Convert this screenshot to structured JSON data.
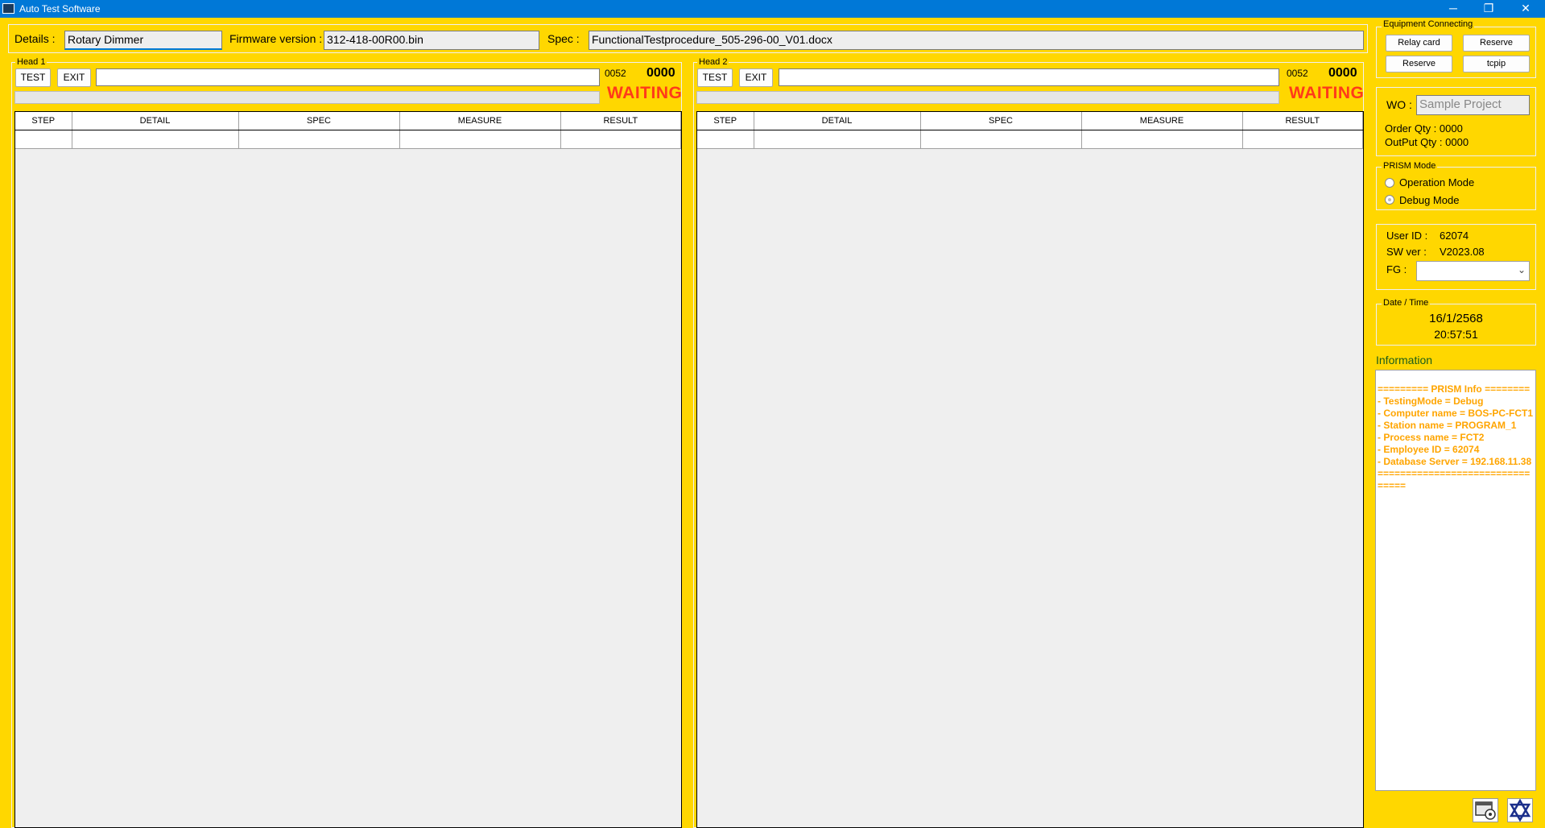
{
  "window": {
    "title": "Auto Test Software",
    "min": "─",
    "max": "❐",
    "close": "✕"
  },
  "header": {
    "details_label": "Details :",
    "details_value": "Rotary Dimmer",
    "firmware_label": "Firmware version :",
    "firmware_value": "312-418-00R00.bin",
    "spec_label": "Spec :",
    "spec_value": "FunctionalTestprocedure_505-296-00_V01.docx"
  },
  "heads": [
    {
      "title": "Head 1",
      "test": "TEST",
      "exit": "EXIT",
      "code": "0052",
      "count": "0000",
      "status": "WAITING",
      "progress": 0,
      "columns": [
        "STEP",
        "DETAIL",
        "SPEC",
        "MEASURE",
        "RESULT"
      ]
    },
    {
      "title": "Head 2",
      "test": "TEST",
      "exit": "EXIT",
      "code": "0052",
      "count": "0000",
      "status": "WAITING",
      "progress": 0,
      "columns": [
        "STEP",
        "DETAIL",
        "SPEC",
        "MEASURE",
        "RESULT"
      ]
    }
  ],
  "equipment": {
    "title": "Equipment Connecting",
    "buttons": [
      "Relay card",
      "Reserve",
      "Reserve",
      "tcpip"
    ]
  },
  "workorder": {
    "wo_label": "WO :",
    "wo_value": "Sample Project",
    "order_qty": "Order Qty : 0000",
    "output_qty": "OutPut Qty : 0000"
  },
  "prism": {
    "title": "PRISM Mode",
    "operation": "Operation Mode",
    "debug": "Debug Mode",
    "selected": "debug"
  },
  "user": {
    "user_label": "User ID :",
    "user_value": "62074",
    "sw_label": "SW ver :",
    "sw_value": "V2023.08",
    "fg_label": "FG :",
    "fg_value": ""
  },
  "datetime": {
    "title": "Date / Time",
    "date": "16/1/2568",
    "time": "20:57:51"
  },
  "information": {
    "title": "Information",
    "text": "========= PRISM Info ========\n- TestingMode = Debug\n- Computer name = BOS-PC-FCT1\n- Station name = PROGRAM_1\n- Process name = FCT2\n- Employee ID = 62074\n- Database Server = 192.168.11.38\n================================"
  },
  "icons": {
    "settings": "settings-window-icon",
    "star": "star-of-david-icon"
  },
  "colors": {
    "background": "#FFD700",
    "titlebar": "#0078D7",
    "waiting": "#FF3A1A",
    "info_text": "#FFA500"
  }
}
